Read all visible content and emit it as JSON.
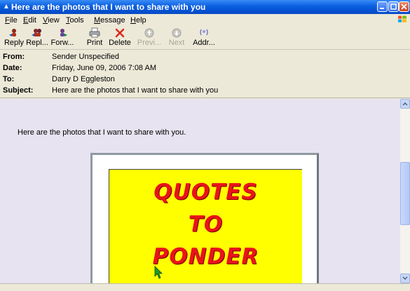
{
  "window": {
    "title": "Here are the photos that I want to share with you"
  },
  "menu": [
    {
      "label": "File",
      "mnemonic": "F",
      "rest": "ile"
    },
    {
      "label": "Edit",
      "mnemonic": "E",
      "rest": "dit"
    },
    {
      "label": "View",
      "mnemonic": "V",
      "rest": "iew"
    },
    {
      "label": "Tools",
      "mnemonic": "T",
      "rest": "ools"
    },
    {
      "label": "Message",
      "mnemonic": "M",
      "rest": "essage"
    },
    {
      "label": "Help",
      "mnemonic": "H",
      "rest": "elp"
    }
  ],
  "toolbar": {
    "reply": "Reply",
    "reply_all": "Repl...",
    "forward": "Forw...",
    "print": "Print",
    "delete": "Delete",
    "previous": "Previ...",
    "next": "Next",
    "addresses": "Addr..."
  },
  "headers": {
    "from_label": "From:",
    "from_value": "Sender Unspecified",
    "date_label": "Date:",
    "date_value": "Friday, June 09, 2006 7:08 AM",
    "to_label": "To:",
    "to_value": "Darry D Eggleston",
    "subject_label": "Subject:",
    "subject_value": "Here are the photos that I want to share with you"
  },
  "message": {
    "text": "Here are the photos that I want to share with you.",
    "image_lines": [
      "QUOTES",
      "TO",
      "PONDER"
    ]
  },
  "colors": {
    "titlebar": "#0a5fe0",
    "image_background": "#ffff00",
    "image_text": "#e8141a",
    "body_background": "#e7e3f0"
  }
}
